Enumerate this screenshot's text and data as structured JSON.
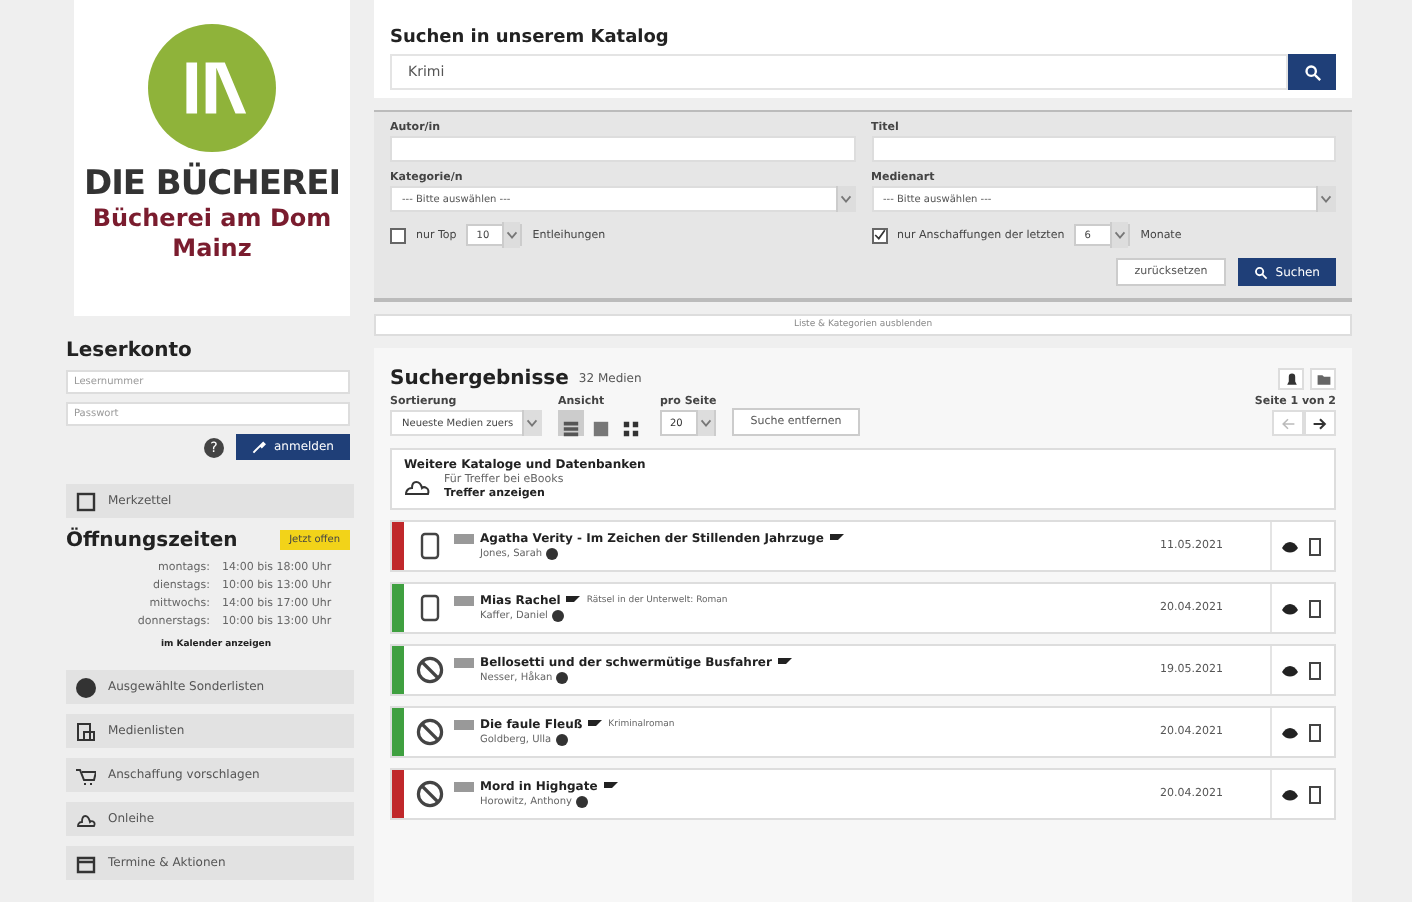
{
  "sidebar": {
    "logo": {
      "brand": "DIE BÜCHEREI",
      "library": "Bücherei am Dom",
      "city": "Mainz"
    },
    "account": {
      "title": "Leserkonto",
      "fields": [
        {
          "placeholder": "Lesernummer"
        },
        {
          "placeholder": "Passwort"
        }
      ],
      "help": "?",
      "button": "anmelden"
    },
    "watchlist": "Merkzettel",
    "hours": {
      "title": "Öffnungszeiten",
      "badge": "Jetzt offen",
      "rows": [
        {
          "day": "montags:",
          "time": "14:00 bis 18:00 Uhr"
        },
        {
          "day": "dienstags:",
          "time": "10:00 bis 13:00 Uhr"
        },
        {
          "day": "mittwochs:",
          "time": "14:00 bis 17:00 Uhr"
        },
        {
          "day": "donnerstags:",
          "time": "10:00 bis 13:00 Uhr"
        }
      ],
      "link": "im Kalender anzeigen"
    },
    "menu": [
      {
        "kind": "disc",
        "label": "Ausgewählte Sonderlisten"
      },
      {
        "kind": "document",
        "label": "Medienlisten"
      },
      {
        "kind": "cart",
        "label": "Anschaffung vorschlagen"
      },
      {
        "kind": "cloud",
        "label": "Onleihe"
      },
      {
        "kind": "calendar",
        "label": "Termine & Aktionen"
      }
    ]
  },
  "search": {
    "title": "Suchen in unserem Katalog",
    "value": "Krimi",
    "fields": [
      {
        "label": "Autor/in"
      },
      {
        "label": "Titel"
      }
    ],
    "selects": [
      {
        "label": "Kategorie/n",
        "value": "--- Bitte auswählen ---"
      },
      {
        "label": "Medienart",
        "value": "--- Bitte auswählen ---"
      }
    ],
    "options": [
      {
        "checked": false,
        "prefix": "nur Top",
        "value": "10",
        "suffix": "Entleihungen"
      },
      {
        "checked": true,
        "prefix": "nur Anschaffungen der letzten",
        "value": "6",
        "suffix": "Monate"
      }
    ],
    "reset": "zurücksetzen",
    "submit": "Suchen",
    "toggle": "Liste & Kategorien ausblenden"
  },
  "results": {
    "title": "Suchergebnisse",
    "count": "32 Medien",
    "sort": {
      "label": "Sortierung",
      "value": "Neueste Medien zuers"
    },
    "view": {
      "label": "Ansicht",
      "options": [
        {
          "kind": "list",
          "selected": true
        },
        {
          "kind": "compact",
          "selected": false
        },
        {
          "kind": "grid",
          "selected": false
        }
      ]
    },
    "per_page": {
      "label": "pro Seite",
      "value": "20"
    },
    "remove": "Suche entfernen",
    "page": "Seite 1 von 2",
    "more": {
      "title": "Weitere Kataloge und Datenbanken",
      "text": "Für Treffer bei eBooks",
      "link": "Treffer anzeigen"
    },
    "items": [
      {
        "kind": "device",
        "color": "#c0282b",
        "title": "Agatha Verity - Im Zeichen der Stillenden Jahrzuge",
        "author": "Jones, Sarah",
        "date": "11.05.2021"
      },
      {
        "kind": "device",
        "color": "#3fa040",
        "title": "Mias Rachel",
        "subtitle": "Rätsel in der Unterwelt: Roman",
        "author": "Kaffer, Daniel",
        "date": "20.04.2021"
      },
      {
        "kind": "blocked",
        "color": "#3fa040",
        "title": "Bellosetti und der schwermütige Busfahrer",
        "author": "Nesser, Håkan",
        "date": "19.05.2021"
      },
      {
        "kind": "blocked",
        "color": "#3fa040",
        "title": "Die faule Fleuß",
        "subtitle": "Kriminalroman",
        "author": "Goldberg, Ulla",
        "date": "20.04.2021"
      },
      {
        "kind": "blocked",
        "color": "#c0282b",
        "title": "Mord in Highgate",
        "author": "Horowitz, Anthony",
        "date": "20.04.2021"
      }
    ]
  }
}
